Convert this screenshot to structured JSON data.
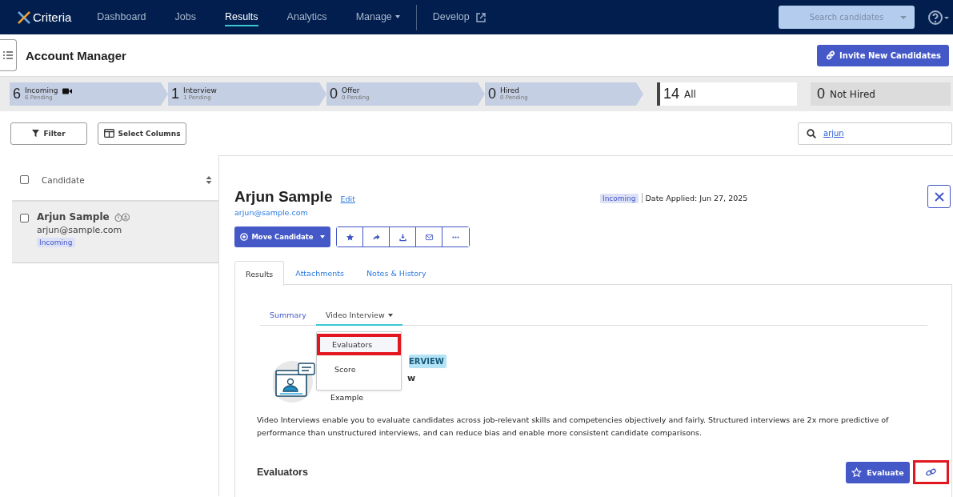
{
  "nav": {
    "logo": "Criteria",
    "items": [
      {
        "label": "Dashboard",
        "selected": false,
        "dropdown": false
      },
      {
        "label": "Jobs",
        "selected": false,
        "dropdown": false
      },
      {
        "label": "Results",
        "selected": true,
        "dropdown": false
      },
      {
        "label": "Analytics",
        "selected": false,
        "dropdown": false
      },
      {
        "label": "Manage",
        "selected": false,
        "dropdown": true
      }
    ],
    "develop": "Develop",
    "search": {
      "placeholder": "Search candidates"
    }
  },
  "header": {
    "title": "Account Manager",
    "invite_button": "Invite New Candidates"
  },
  "pipeline": {
    "stages": [
      {
        "count": "6",
        "label": "Incoming",
        "pending": "6 Pending",
        "video": true
      },
      {
        "count": "1",
        "label": "Interview",
        "pending": "1 Pending",
        "video": false
      },
      {
        "count": "0",
        "label": "Offer",
        "pending": "0 Pending",
        "video": false
      },
      {
        "count": "0",
        "label": "Hired",
        "pending": "0 Pending",
        "video": false
      }
    ],
    "totals": [
      {
        "count": "14",
        "label": "All",
        "selected": true
      },
      {
        "count": "0",
        "label": "Not Hired",
        "selected": false
      }
    ]
  },
  "toolbar": {
    "filter_button": "Filter",
    "columns_button": "Select Columns",
    "search": {
      "value": "arjun"
    }
  },
  "list": {
    "column": "Candidate",
    "checked": false,
    "rows": [
      {
        "name": "Arjun Sample",
        "email": "arjun@sample.com",
        "status": "Incoming",
        "checked": false,
        "selected": true
      }
    ]
  },
  "detail": {
    "name": "Arjun Sample",
    "edit": "Edit",
    "email": "arjun@sample.com",
    "status": "Incoming",
    "date_applied": "Date Applied: Jun 27, 2025",
    "move_button": "Move Candidate",
    "actions": [
      {
        "kind": "star"
      },
      {
        "kind": "share"
      },
      {
        "kind": "download"
      },
      {
        "kind": "mail"
      },
      {
        "kind": "more"
      }
    ],
    "tabs": [
      {
        "label": "Results",
        "selected": true
      },
      {
        "label": "Attachments",
        "selected": false
      },
      {
        "label": "Notes & History",
        "selected": false
      }
    ],
    "subtabs": [
      {
        "label": "Summary",
        "selected": false,
        "dropdown": false
      },
      {
        "label": "Video Interview",
        "selected": true,
        "dropdown": true
      }
    ],
    "menu": [
      {
        "label": "Evaluators",
        "highlighted": true
      },
      {
        "label": "Score",
        "highlighted": false
      }
    ],
    "hero": {
      "badge": "ERVIEW",
      "title": "w",
      "subtitle": "Example"
    },
    "description": "Video Interviews enable you to evaluate candidates across job-relevant skills and competencies objectively and fairly. Structured interviews are 2x more predictive of performance than unstructured interviews, and can reduce bias and enable more consistent candidate comparisons.",
    "section_title": "Evaluators",
    "evaluate_button": "Evaluate",
    "link_button": {
      "highlighted": true
    }
  }
}
